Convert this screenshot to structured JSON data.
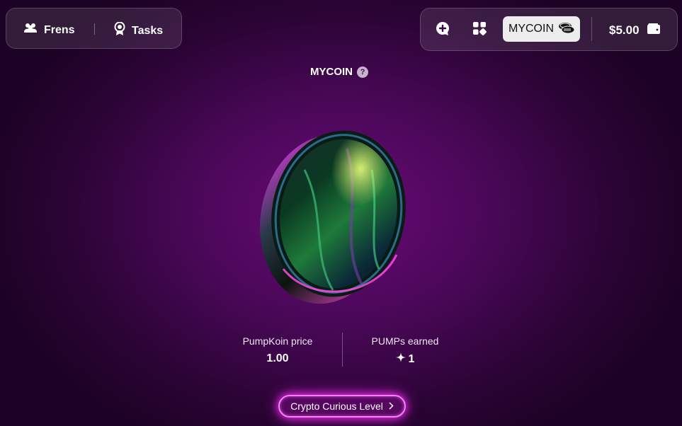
{
  "nav": {
    "frens_label": "Frens",
    "tasks_label": "Tasks"
  },
  "header_right": {
    "coin_label": "MYCOIN",
    "balance": "$5.00"
  },
  "main": {
    "title": "MYCOIN",
    "help_glyph": "?",
    "stats": {
      "price_label": "PumpKoin price",
      "price_value": "1.00",
      "earned_label": "PUMPs earned",
      "earned_value": "1"
    },
    "level_button": "Crypto Curious Level"
  },
  "colors": {
    "accent": "#ff2dff",
    "background": "#4a0858"
  },
  "icons": [
    "friends-icon",
    "award-icon",
    "chat-plus-icon",
    "apps-grid-icon",
    "coin-stack-icon",
    "wallet-icon",
    "help-icon",
    "sparkle-icon",
    "chevron-right-icon"
  ]
}
